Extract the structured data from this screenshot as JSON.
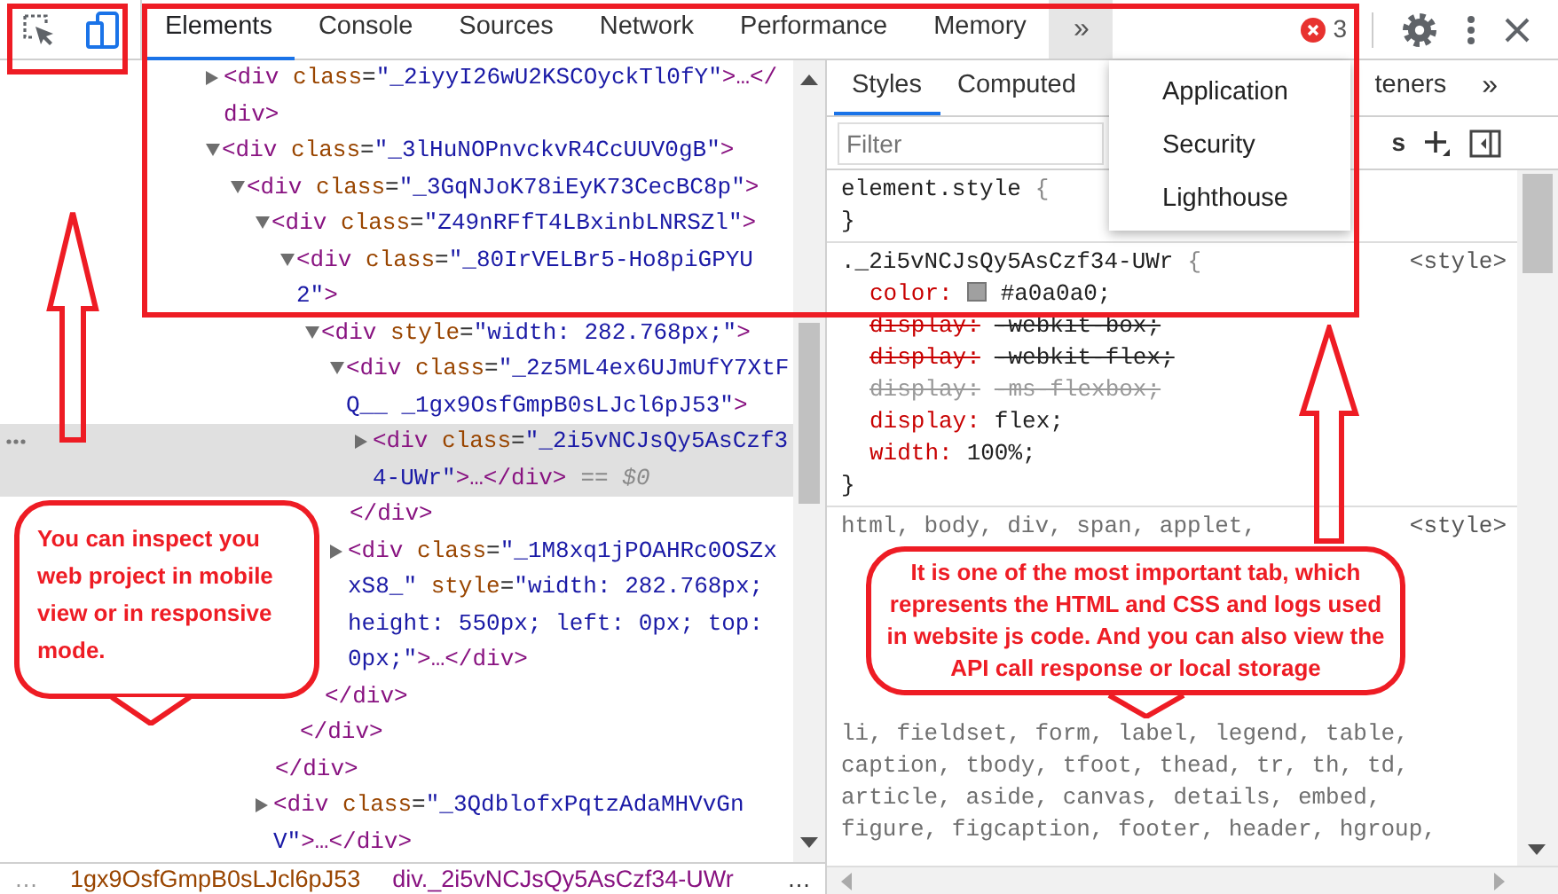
{
  "tabs": [
    {
      "label": "Elements",
      "selected": true
    },
    {
      "label": "Console",
      "selected": false
    },
    {
      "label": "Sources",
      "selected": false
    },
    {
      "label": "Network",
      "selected": false
    },
    {
      "label": "Performance",
      "selected": false
    },
    {
      "label": "Memory",
      "selected": false
    }
  ],
  "more_tabs": {
    "label": "»",
    "expanded": true,
    "menu": [
      "Application",
      "Security",
      "Lighthouse"
    ]
  },
  "error_count": "3",
  "elements_tree": [
    {
      "tag": "<div class=\"_2iyyI26wU2KSCOyckTl0fY\">…</div>",
      "expanded": false,
      "selected": false
    },
    {
      "tag": "<div class=\"_3lHuNOPnvckvR4CcUUV0gB\">",
      "expanded": true,
      "selected": false,
      "children": [
        {
          "tag": "<div class=\"_3GqNJoK78iEyK73CecBC8p\">",
          "expanded": true,
          "selected": false,
          "children": [
            {
              "tag": "<div class=\"Z49nRFfT4LBxinbLNRSZl\">",
              "expanded": true,
              "selected": false,
              "children": [
                {
                  "tag": "<div class=\"_80IrVELBr5-Ho8piGPYU2\">",
                  "expanded": true,
                  "selected": false,
                  "children": [
                    {
                      "tag": "<div style=\"width: 282.768px;\">",
                      "expanded": true,
                      "selected": false,
                      "children": [
                        {
                          "tag": "<div class=\"_2z5ML4ex6UJmUfY7XtFQ__ _1gx9OsfGmpB0sLJcl6pJ53\">",
                          "expanded": true,
                          "selected": false,
                          "children": [
                            {
                              "tag": "<div class=\"_2i5vNCJsQy5AsCzf34-UWr\">…</div>",
                              "suffix": "== $0",
                              "expanded": false,
                              "selected": true
                            }
                          ],
                          "close": "</div>"
                        },
                        {
                          "tag": "<div class=\"_1M8xq1jPOAHRc0OSZxxS8_\" style=\"width: 282.768px; height: 550px; left: 0px; top: 0px;\">…</div>",
                          "expanded": false,
                          "selected": false
                        }
                      ],
                      "close": "</div>"
                    }
                  ],
                  "close": "</div>"
                }
              ],
              "close": "</div>"
            },
            {
              "tag": "<div class=\"_3QdblofxPqtzAdaMHVvGnV\">…</div>",
              "expanded": false,
              "selected": false
            }
          ]
        }
      ]
    }
  ],
  "breadcrumbs": {
    "more_left": "…",
    "items": [
      {
        "class_name": "1gx9OsfGmpB0sLJcl6pJ53"
      },
      {
        "tag": "div",
        "class_name": "._2i5vNCJsQy5AsCzf34-UWr"
      }
    ],
    "more_right": "…"
  },
  "styles": {
    "tabs": [
      {
        "label": "Styles",
        "selected": true
      },
      {
        "label": "Computed",
        "selected": false
      },
      {
        "label": "teners",
        "selected": false
      }
    ],
    "more": "»",
    "filter": {
      "placeholder": "Filter"
    },
    "filter_toggle": "s",
    "rules": [
      {
        "kind": "rule",
        "selector": "element.style",
        "brace": "{",
        "close": "}"
      },
      {
        "kind": "rule",
        "selector": "._2i5vNCJsQy5AsCzf34-UWr",
        "brace": "{",
        "source": "<style>",
        "properties": [
          {
            "kind": "color",
            "name": "color:",
            "value": "#a0a0a0;",
            "overridden": false,
            "unsupported": false
          },
          {
            "kind": "plain",
            "name": "display:",
            "value": "-webkit-box;",
            "overridden": true,
            "unsupported": false
          },
          {
            "kind": "plain",
            "name": "display:",
            "value": "-webkit-flex;",
            "overridden": true,
            "unsupported": false
          },
          {
            "kind": "plain",
            "name": "display:",
            "value": "-ms-flexbox;",
            "overridden": true,
            "unsupported": true
          },
          {
            "kind": "plain",
            "name": "display:",
            "value": "flex;",
            "overridden": false,
            "unsupported": false
          },
          {
            "kind": "plain",
            "name": "width:",
            "value": "100%;",
            "overridden": false,
            "unsupported": false
          }
        ],
        "close": "}"
      },
      {
        "kind": "selector_list",
        "source": "<style>",
        "lines": [
          {
            "kind": "code",
            "text": "html, body, div, span, applet,"
          },
          {
            "kind": "callout",
            "text": "It is one of the most important tab, which represents the HTML and CSS and logs used in website js code. And you can also view the API call response or local storage"
          },
          {
            "kind": "code",
            "text": "li, fieldset, form, label, legend, table,"
          },
          {
            "kind": "code",
            "text": "caption, tbody, tfoot, thead, tr, th, td,"
          },
          {
            "kind": "code",
            "text": "article, aside, canvas, details, embed,"
          },
          {
            "kind": "code",
            "text": "figure, figcaption, footer, header, hgroup,"
          }
        ]
      }
    ]
  },
  "annotations": [
    {
      "text": "You can inspect you web project in mobile view or in responsive mode."
    }
  ]
}
